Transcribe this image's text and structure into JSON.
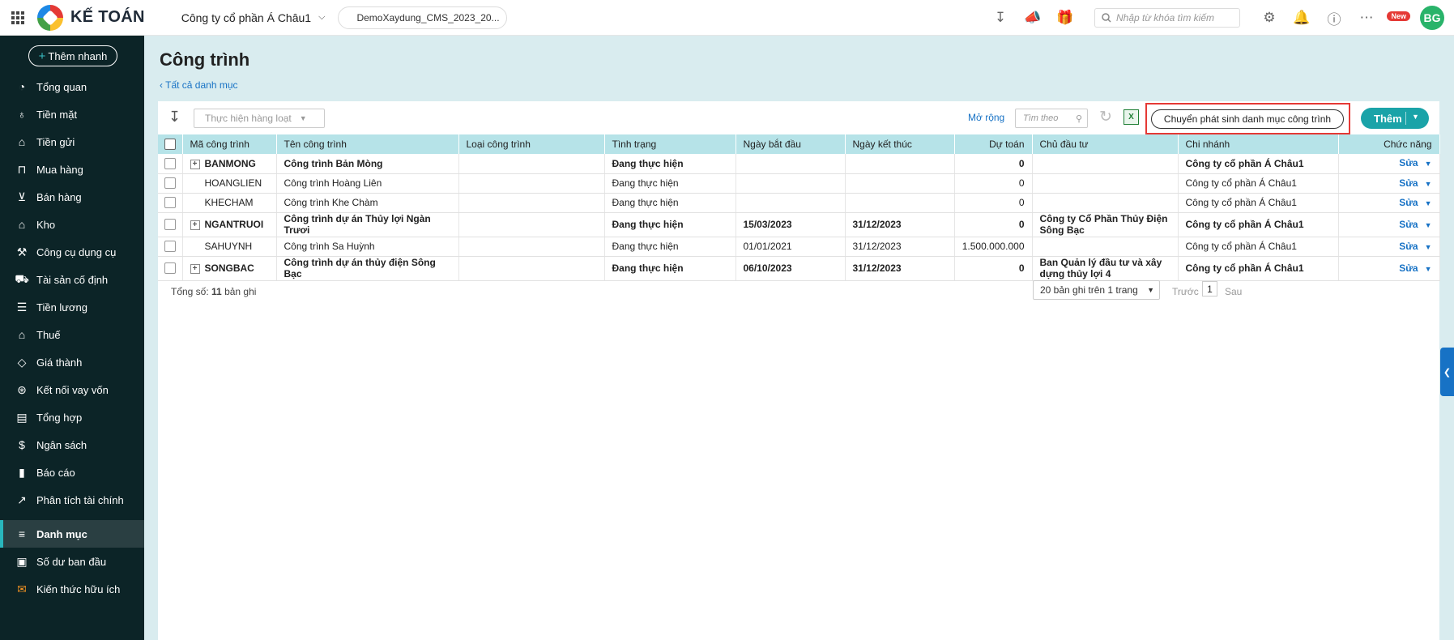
{
  "header": {
    "apps_icon": "apps-grid-icon",
    "brand": "KẾ TOÁN",
    "company": "Công ty cổ phần Á Châu1",
    "database": "DemoXaydung_CMS_2023_20...",
    "search_placeholder": "Nhập từ khóa tìm kiếm",
    "new_badge": "New",
    "avatar": "BG"
  },
  "sidebar": {
    "quick_add": "Thêm nhanh",
    "items": [
      {
        "label": "Tổng quan",
        "icon": "dashboard-icon",
        "active": false
      },
      {
        "label": "Tiền mặt",
        "icon": "money-bag-icon",
        "active": false
      },
      {
        "label": "Tiền gửi",
        "icon": "bank-icon",
        "active": false
      },
      {
        "label": "Mua hàng",
        "icon": "shopping-bag-icon",
        "active": false
      },
      {
        "label": "Bán hàng",
        "icon": "cart-icon",
        "active": false
      },
      {
        "label": "Kho",
        "icon": "warehouse-icon",
        "active": false
      },
      {
        "label": "Công cụ dụng cụ",
        "icon": "tools-icon",
        "active": false
      },
      {
        "label": "Tài sản cố định",
        "icon": "truck-icon",
        "active": false
      },
      {
        "label": "Tiền lương",
        "icon": "payroll-icon",
        "active": false
      },
      {
        "label": "Thuế",
        "icon": "tax-building-icon",
        "active": false
      },
      {
        "label": "Giá thành",
        "icon": "price-tag-icon",
        "active": false
      },
      {
        "label": "Kết nối vay vốn",
        "icon": "loan-icon",
        "active": false
      },
      {
        "label": "Tổng hợp",
        "icon": "ledger-icon",
        "active": false
      },
      {
        "label": "Ngân sách",
        "icon": "budget-icon",
        "active": false
      },
      {
        "label": "Báo cáo",
        "icon": "bar-chart-icon",
        "active": false
      },
      {
        "label": "Phân tích tài chính",
        "icon": "trend-icon",
        "active": false
      },
      {
        "label": "Danh mục",
        "icon": "list-icon",
        "active": true
      },
      {
        "label": "Số dư ban đầu",
        "icon": "balance-icon",
        "active": false
      },
      {
        "label": "Kiến thức hữu ích",
        "icon": "knowledge-icon",
        "active": false
      }
    ]
  },
  "page": {
    "title": "Công trình",
    "back_link": "Tất cả danh mục"
  },
  "toolbar": {
    "bulk_action": "Thực hiện hàng loạt",
    "expand": "Mở rộng",
    "search_placeholder": "Tìm theo",
    "transfer_button": "Chuyển phát sinh danh mục công trình",
    "add_button": "Thêm"
  },
  "table": {
    "columns": [
      "Mã công trình",
      "Tên công trình",
      "Loại công trình",
      "Tình trạng",
      "Ngày bắt đầu",
      "Ngày kết thúc",
      "Dự toán",
      "Chủ đầu tư",
      "Chi nhánh",
      "Chức năng"
    ],
    "rows": [
      {
        "code": "BANMONG",
        "name": "Công trình Bản Mòng",
        "type": "",
        "status": "Đang thực hiện",
        "start": "",
        "end": "",
        "budget": "0",
        "investor": "",
        "branch": "Công ty cổ phần Á Châu1",
        "action": "Sửa",
        "bold": true,
        "expandable": true
      },
      {
        "code": "HOANGLIEN",
        "name": "Công trình Hoàng Liên",
        "type": "",
        "status": "Đang thực hiện",
        "start": "",
        "end": "",
        "budget": "0",
        "investor": "",
        "branch": "Công ty cổ phần Á Châu1",
        "action": "Sửa",
        "bold": false,
        "expandable": false
      },
      {
        "code": "KHECHAM",
        "name": "Công trình Khe Chàm",
        "type": "",
        "status": "Đang thực hiện",
        "start": "",
        "end": "",
        "budget": "0",
        "investor": "",
        "branch": "Công ty cổ phần Á Châu1",
        "action": "Sửa",
        "bold": false,
        "expandable": false
      },
      {
        "code": "NGANTRUOI",
        "name": "Công trình dự án Thủy lợi Ngàn Trươi",
        "type": "",
        "status": "Đang thực hiện",
        "start": "15/03/2023",
        "end": "31/12/2023",
        "budget": "0",
        "investor": "Công ty Cổ Phần Thủy Điện Sông Bạc",
        "branch": "Công ty cổ phần Á Châu1",
        "action": "Sửa",
        "bold": true,
        "expandable": true
      },
      {
        "code": "SAHUYNH",
        "name": "Công trình Sa Huỳnh",
        "type": "",
        "status": "Đang thực hiện",
        "start": "01/01/2021",
        "end": "31/12/2023",
        "budget": "1.500.000.000",
        "investor": "",
        "branch": "Công ty cổ phần Á Châu1",
        "action": "Sửa",
        "bold": false,
        "expandable": false
      },
      {
        "code": "SONGBAC",
        "name": "Công trình dự án thủy điện Sông Bạc",
        "type": "",
        "status": "Đang thực hiện",
        "start": "06/10/2023",
        "end": "31/12/2023",
        "budget": "0",
        "investor": "Ban Quản lý đầu tư và xây dựng thủy lợi 4",
        "branch": "Công ty cổ phần Á Châu1",
        "action": "Sửa",
        "bold": true,
        "expandable": true
      }
    ]
  },
  "footer": {
    "total_label": "Tổng số:",
    "total_count": "11",
    "total_unit": "bản ghi",
    "page_size": "20 bản ghi trên 1 trang",
    "prev": "Trước",
    "page": "1",
    "next": "Sau"
  },
  "colors": {
    "sidebar": "#0c2427",
    "accent": "#1aa3a8",
    "header_row": "#b6e3e8",
    "highlight": "#e53935"
  }
}
